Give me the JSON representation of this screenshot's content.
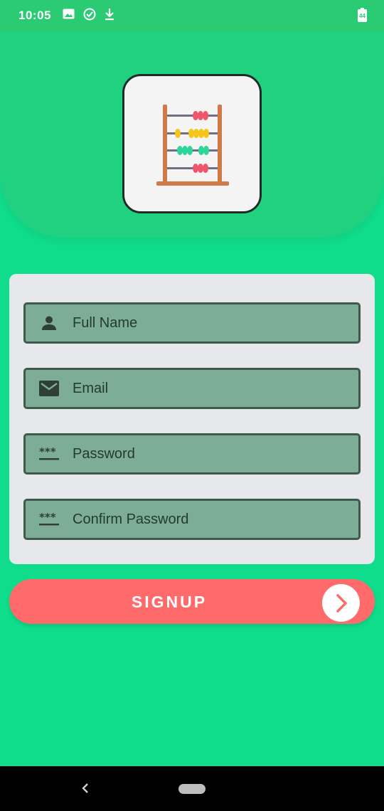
{
  "status_bar": {
    "time": "10:05",
    "battery": "44",
    "icons": [
      "image-icon",
      "check-circle-icon",
      "download-icon"
    ]
  },
  "logo": {
    "icon": "abacus-icon"
  },
  "form": {
    "fields": [
      {
        "icon": "person-icon",
        "placeholder": "Full Name",
        "value": ""
      },
      {
        "icon": "mail-icon",
        "placeholder": "Email",
        "value": ""
      },
      {
        "icon": "password-icon",
        "placeholder": "Password",
        "value": ""
      },
      {
        "icon": "password-icon",
        "placeholder": "Confirm Password",
        "value": ""
      }
    ]
  },
  "signup_button": {
    "label": "SIGNUP",
    "icon": "chevron-right-icon"
  },
  "colors": {
    "background": "#10DD8B",
    "header": "#20D27F",
    "field_fill": "#7DAD96",
    "field_border": "#3F5A4D",
    "accent": "#FF6B6B"
  }
}
